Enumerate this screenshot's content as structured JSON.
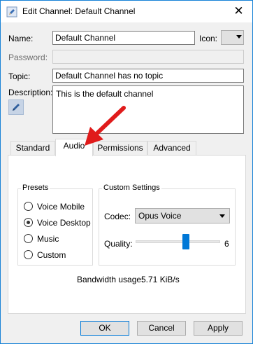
{
  "window": {
    "title": "Edit Channel: Default Channel",
    "close_glyph": "✕",
    "accent_color": "#0078d7"
  },
  "form": {
    "name_label": "Name:",
    "name_value": "Default Channel",
    "icon_label": "Icon:",
    "password_label": "Password:",
    "password_value": "",
    "topic_label": "Topic:",
    "topic_value": "Default Channel has no topic",
    "description_label": "Description:",
    "description_value": "This is the default channel"
  },
  "tabs": [
    {
      "label": "Standard",
      "active": false
    },
    {
      "label": "Audio",
      "active": true
    },
    {
      "label": "Permissions",
      "active": false
    },
    {
      "label": "Advanced",
      "active": false
    }
  ],
  "presets": {
    "title": "Presets",
    "options": [
      {
        "label": "Voice Mobile",
        "selected": false
      },
      {
        "label": "Voice Desktop",
        "selected": true
      },
      {
        "label": "Music",
        "selected": false
      },
      {
        "label": "Custom",
        "selected": false
      }
    ]
  },
  "custom_settings": {
    "title": "Custom Settings",
    "codec_label": "Codec:",
    "codec_value": "Opus Voice",
    "quality_label": "Quality:",
    "quality_value": "6",
    "quality_level": 0.6
  },
  "bandwidth": {
    "label": "Bandwidth usage:",
    "value": "5.71 KiB/s"
  },
  "buttons": {
    "ok": "OK",
    "cancel": "Cancel",
    "apply": "Apply"
  },
  "annotation": {
    "arrow_color": "#e01b1b"
  }
}
